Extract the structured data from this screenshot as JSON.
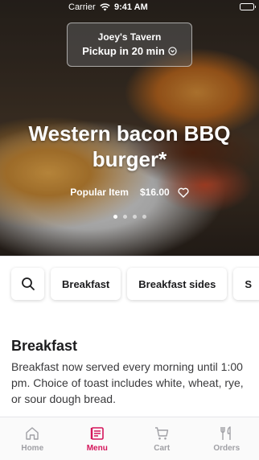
{
  "status_bar": {
    "carrier": "Carrier",
    "time": "9:41 AM"
  },
  "pickup": {
    "restaurant": "Joey's Tavern",
    "eta": "Pickup in 20 min"
  },
  "hero": {
    "title": "Western bacon BBQ burger*",
    "badge": "Popular Item",
    "price": "$16.00",
    "carousel_pages": 4,
    "active_page": 1
  },
  "categories": [
    {
      "label": "Breakfast"
    },
    {
      "label": "Breakfast sides"
    },
    {
      "label": "S"
    }
  ],
  "section": {
    "title": "Breakfast",
    "description": "Breakfast now served every morning until 1:00 pm. Choice of toast includes white, wheat, rye, or sour dough bread."
  },
  "tabs": [
    {
      "label": "Home",
      "icon": "home-icon"
    },
    {
      "label": "Menu",
      "icon": "menu-icon"
    },
    {
      "label": "Cart",
      "icon": "cart-icon"
    },
    {
      "label": "Orders",
      "icon": "orders-icon"
    }
  ],
  "active_tab": "Menu",
  "colors": {
    "accent": "#d4145a",
    "inactive": "#a0a0a5"
  }
}
